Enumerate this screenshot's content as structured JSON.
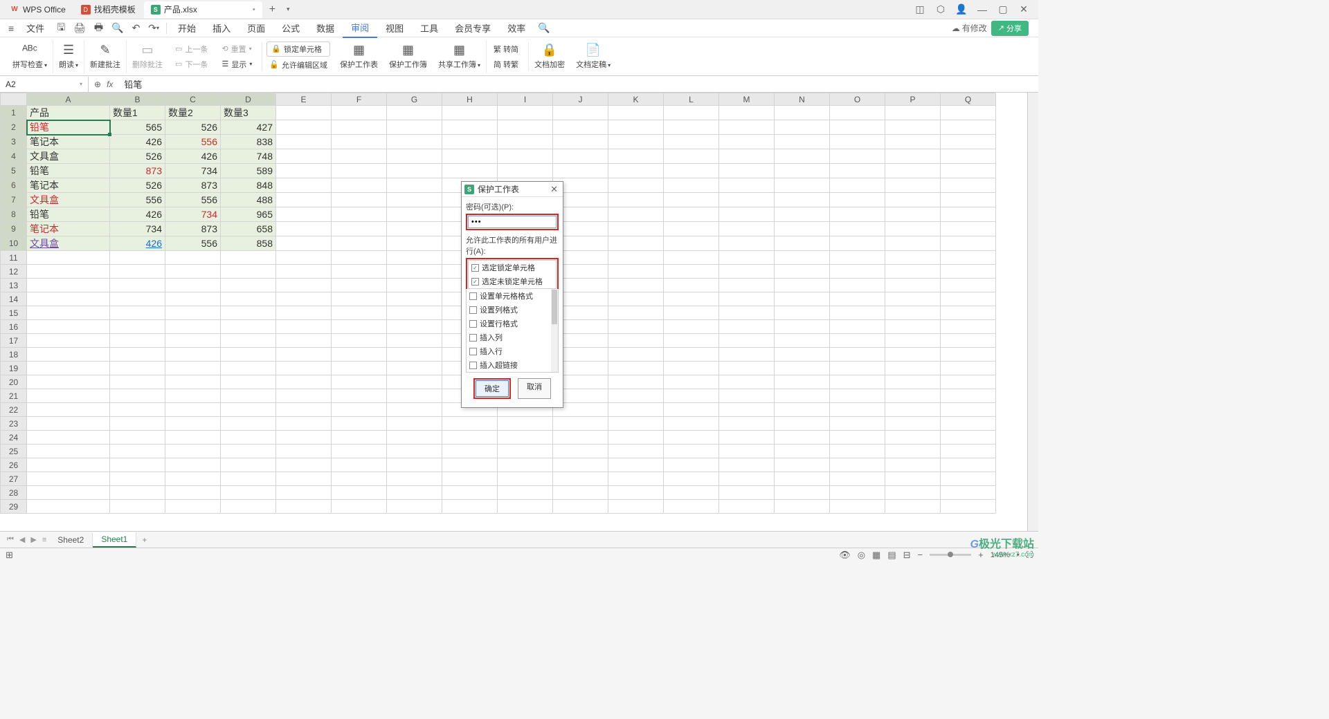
{
  "titlebar": {
    "tabs": [
      {
        "icon": "W",
        "label": "WPS Office"
      },
      {
        "icon": "D",
        "label": "找稻壳模板"
      },
      {
        "icon": "S",
        "label": "产品.xlsx",
        "dirty": "•"
      }
    ],
    "add": "+"
  },
  "menubar": {
    "hamburger": "≡",
    "file": "文件",
    "tabs": [
      "开始",
      "插入",
      "页面",
      "公式",
      "数据",
      "审阅",
      "视图",
      "工具",
      "会员专享",
      "效率"
    ],
    "active_index": 5,
    "status": "有修改",
    "share": "分享"
  },
  "ribbon": {
    "spell": "拼写检查",
    "read": "朗读",
    "new_comment": "新建批注",
    "del_comment": "删除批注",
    "prev": "上一条",
    "next": "下一条",
    "reset": "重置",
    "show": "显示",
    "lock_cell": "锁定单元格",
    "allow_edit": "允许编辑区域",
    "protect_sheet": "保护工作表",
    "protect_book": "保护工作簿",
    "share_book": "共享工作簿",
    "trad_simp": "繁 转简",
    "simp_trad": "简 转繁",
    "doc_encrypt": "文档加密",
    "doc_finalize": "文档定稿"
  },
  "formula_bar": {
    "name": "A2",
    "fx": "fx",
    "value": "铅笔"
  },
  "columns": [
    "A",
    "B",
    "C",
    "D",
    "E",
    "F",
    "G",
    "H",
    "I",
    "J",
    "K",
    "L",
    "M",
    "N",
    "O",
    "P",
    "Q"
  ],
  "rows": 29,
  "data": {
    "header": [
      "产品",
      "数量1",
      "数量2",
      "数量3"
    ],
    "body": [
      {
        "a": "铅笔",
        "a_cls": "red",
        "b": "565",
        "c": "526",
        "d": "427"
      },
      {
        "a": "笔记本",
        "b": "426",
        "c": "556",
        "c_cls": "red",
        "d": "838"
      },
      {
        "a": "文具盒",
        "b": "526",
        "c": "426",
        "d": "748"
      },
      {
        "a": "铅笔",
        "b": "873",
        "b_cls": "red",
        "c": "734",
        "d": "589"
      },
      {
        "a": "笔记本",
        "b": "526",
        "c": "873",
        "d": "848"
      },
      {
        "a": "文具盒",
        "a_cls": "red",
        "b": "556",
        "c": "556",
        "d": "488"
      },
      {
        "a": "铅笔",
        "b": "426",
        "c": "734",
        "c_cls": "red",
        "d": "965"
      },
      {
        "a": "笔记本",
        "a_cls": "red",
        "b": "734",
        "c": "873",
        "d": "658"
      },
      {
        "a": "文具盒",
        "a_cls": "purple",
        "b": "426",
        "b_cls": "link",
        "c": "556",
        "d": "858"
      }
    ]
  },
  "dialog": {
    "title": "保护工作表",
    "pwd_label": "密码(可选)(P):",
    "pwd_value": "•••",
    "allow_label": "允许此工作表的所有用户进行(A):",
    "items": [
      {
        "label": "选定锁定单元格",
        "checked": true,
        "boxed": true
      },
      {
        "label": "选定未锁定单元格",
        "checked": true,
        "boxed": true
      },
      {
        "label": "设置单元格格式",
        "checked": false
      },
      {
        "label": "设置列格式",
        "checked": false
      },
      {
        "label": "设置行格式",
        "checked": false
      },
      {
        "label": "插入列",
        "checked": false
      },
      {
        "label": "插入行",
        "checked": false
      },
      {
        "label": "插入超链接",
        "checked": false
      }
    ],
    "ok": "确定",
    "cancel": "取消"
  },
  "sheet_tabs": {
    "tabs": [
      "Sheet2",
      "Sheet1"
    ],
    "active_index": 1
  },
  "statusbar": {
    "zoom": "145%"
  },
  "watermark": {
    "logo_g": "G",
    "logo_txt": "极光下载站",
    "url": "www.xz7.com"
  }
}
